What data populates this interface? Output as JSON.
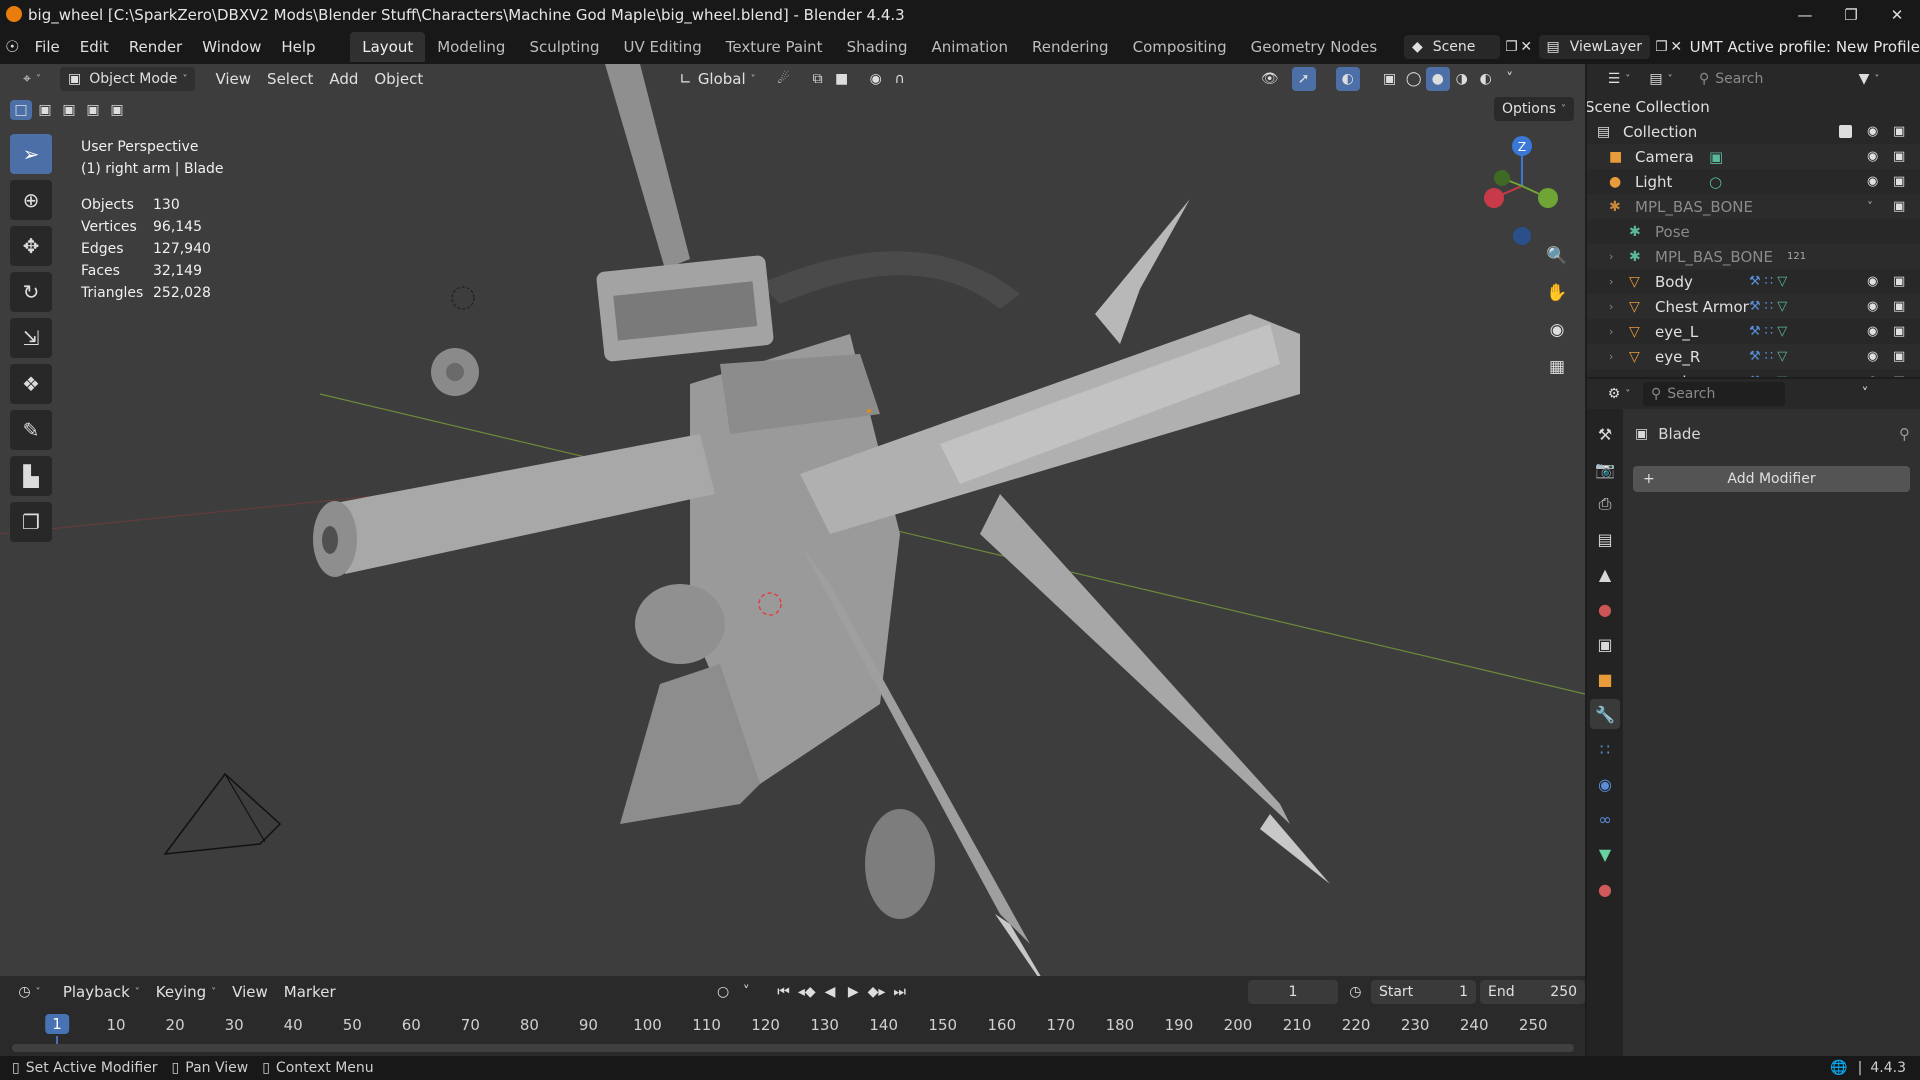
{
  "window": {
    "title": "big_wheel [C:\\SparkZero\\DBXV2 Mods\\Blender Stuff\\Characters\\Machine God Maple\\big_wheel.blend] - Blender 4.4.3",
    "controls": [
      "—",
      "❐",
      "✕"
    ]
  },
  "menubar": {
    "menus": [
      "File",
      "Edit",
      "Render",
      "Window",
      "Help"
    ],
    "workspaces": [
      "Layout",
      "Modeling",
      "Sculpting",
      "UV Editing",
      "Texture Paint",
      "Shading",
      "Animation",
      "Rendering",
      "Compositing",
      "Geometry Nodes"
    ],
    "active_workspace": "Layout",
    "scene": "Scene",
    "view_layer": "ViewLayer",
    "umt_profile": "UMT Active profile: New Profile"
  },
  "viewport": {
    "mode": "Object Mode",
    "menus": [
      "View",
      "Select",
      "Add",
      "Object"
    ],
    "orientation": "Global",
    "options_label": "Options",
    "view_name": "User Perspective",
    "context": "(1) right arm | Blade",
    "stats": [
      {
        "label": "Objects",
        "value": "130"
      },
      {
        "label": "Vertices",
        "value": "96,145"
      },
      {
        "label": "Edges",
        "value": "127,940"
      },
      {
        "label": "Faces",
        "value": "32,149"
      },
      {
        "label": "Triangles",
        "value": "252,028"
      }
    ],
    "gizmo": {
      "z": "Z"
    }
  },
  "outliner": {
    "search_placeholder": "Search",
    "root": "Scene Collection",
    "rows": [
      {
        "name": "Collection"
      },
      {
        "name": "Camera"
      },
      {
        "name": "Light"
      },
      {
        "name": "MPL_BAS_BONE"
      },
      {
        "name": "Pose"
      },
      {
        "name": "MPL_BAS_BONE",
        "badge": "121"
      },
      {
        "name": "Body"
      },
      {
        "name": "Chest Armor"
      },
      {
        "name": "eye_L"
      },
      {
        "name": "eye_R"
      },
      {
        "name": "eyebrows"
      }
    ]
  },
  "properties": {
    "search_placeholder": "Search",
    "object_name": "Blade",
    "add_modifier": "Add Modifier"
  },
  "timeline": {
    "menus": [
      "Playback",
      "Keying",
      "View",
      "Marker"
    ],
    "current_frame": "1",
    "start_label": "Start",
    "start": "1",
    "end_label": "End",
    "end": "250",
    "ticks": [
      "1",
      "10",
      "20",
      "30",
      "40",
      "50",
      "60",
      "70",
      "80",
      "90",
      "100",
      "110",
      "120",
      "130",
      "140",
      "150",
      "160",
      "170",
      "180",
      "190",
      "200",
      "210",
      "220",
      "230",
      "240",
      "250"
    ]
  },
  "statusbar": {
    "hints": [
      "Set Active Modifier",
      "Pan View",
      "Context Menu"
    ],
    "version": "4.4.3"
  },
  "colors": {
    "accent": "#4d6fa8",
    "viewport_bg": "#3d3d3d",
    "x_axis": "#c83a48",
    "y_axis": "#6ea535",
    "z_axis": "#3a78d8",
    "active_frame": "#4772b3"
  }
}
